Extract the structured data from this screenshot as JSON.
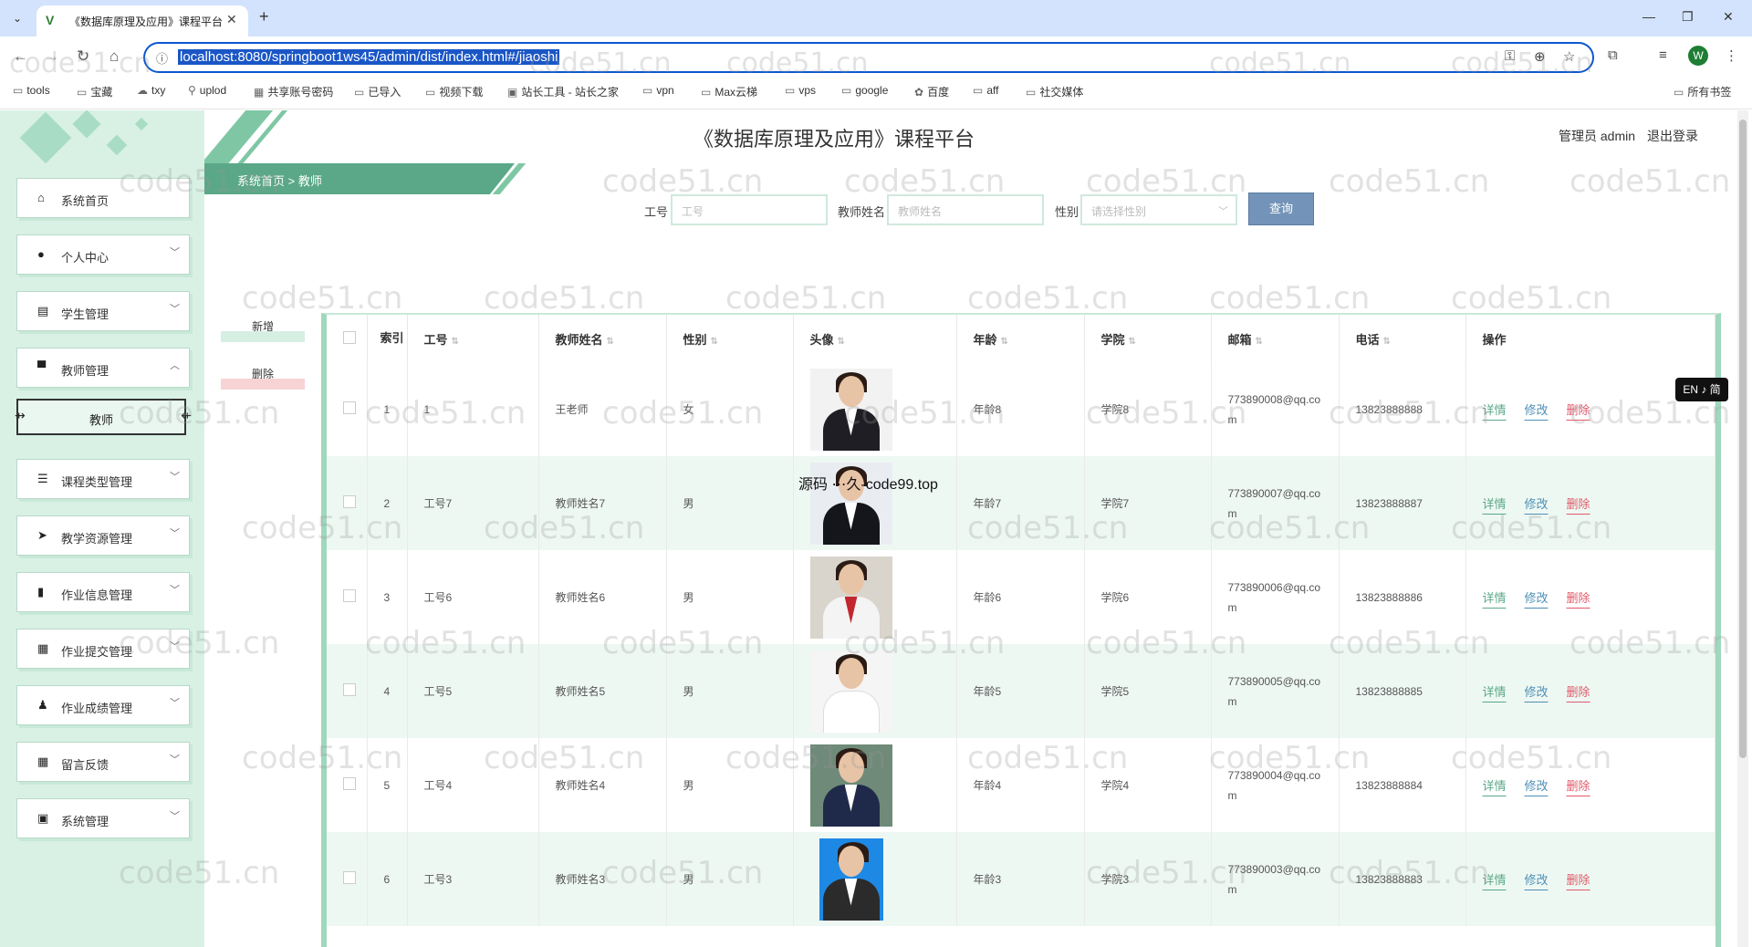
{
  "browser": {
    "tab_title": "《数据库原理及应用》课程平台",
    "favicon": "V",
    "url": "localhost:8080/springboot1ws45/admin/dist/index.html#/jiaoshi",
    "profile_initial": "W",
    "bookmarks": [
      "tools",
      "宝藏",
      "txy",
      "uplod",
      "共享账号密码",
      "已导入",
      "视频下载",
      "站长工具 - 站长之家",
      "vpn",
      "Max云梯",
      "vps",
      "google",
      "百度",
      "aff",
      "社交媒体"
    ],
    "all_bookmarks": "所有书签"
  },
  "header": {
    "title": "《数据库原理及应用》课程平台",
    "user": "管理员 admin",
    "logout": "退出登录",
    "breadcrumb_home": "系统首页",
    "breadcrumb_sep": ">",
    "breadcrumb_current": "教师"
  },
  "sidebar": {
    "items": [
      {
        "label": "系统首页",
        "icon": "home-icon"
      },
      {
        "label": "个人中心",
        "icon": "user-icon"
      },
      {
        "label": "学生管理",
        "icon": "chat-icon"
      },
      {
        "label": "教师管理",
        "icon": "monitor-icon"
      },
      {
        "label": "课程类型管理",
        "icon": "list-icon"
      },
      {
        "label": "教学资源管理",
        "icon": "send-icon"
      },
      {
        "label": "作业信息管理",
        "icon": "chart-icon"
      },
      {
        "label": "作业提交管理",
        "icon": "grid-icon"
      },
      {
        "label": "作业成绩管理",
        "icon": "person-icon"
      },
      {
        "label": "留言反馈",
        "icon": "grid-icon"
      },
      {
        "label": "系统管理",
        "icon": "calendar-icon"
      }
    ],
    "sub_item": "教师"
  },
  "search": {
    "gonghao_label": "工号",
    "gonghao_placeholder": "工号",
    "name_label": "教师姓名",
    "name_placeholder": "教师姓名",
    "gender_label": "性别",
    "gender_placeholder": "请选择性别",
    "button": "查询"
  },
  "actions": {
    "add": "新增",
    "delete": "删除"
  },
  "table": {
    "headers": [
      "索引",
      "工号",
      "教师姓名",
      "性别",
      "头像",
      "年龄",
      "学院",
      "邮箱",
      "电话",
      "操作"
    ],
    "ops": {
      "detail": "详情",
      "edit": "修改",
      "delete": "删除"
    },
    "rows": [
      {
        "index": "1",
        "gonghao": "1",
        "name": "王老师",
        "gender": "女",
        "age": "年龄8",
        "college": "学院8",
        "email": "773890008@qq.com",
        "phone": "13823888888"
      },
      {
        "index": "2",
        "gonghao": "工号7",
        "name": "教师姓名7",
        "gender": "男",
        "age": "年龄7",
        "college": "学院7",
        "email": "773890007@qq.com",
        "phone": "13823888887"
      },
      {
        "index": "3",
        "gonghao": "工号6",
        "name": "教师姓名6",
        "gender": "男",
        "age": "年龄6",
        "college": "学院6",
        "email": "773890006@qq.com",
        "phone": "13823888886"
      },
      {
        "index": "4",
        "gonghao": "工号5",
        "name": "教师姓名5",
        "gender": "男",
        "age": "年龄5",
        "college": "学院5",
        "email": "773890005@qq.com",
        "phone": "13823888885"
      },
      {
        "index": "5",
        "gonghao": "工号4",
        "name": "教师姓名4",
        "gender": "男",
        "age": "年龄4",
        "college": "学院4",
        "email": "773890004@qq.com",
        "phone": "13823888884"
      },
      {
        "index": "6",
        "gonghao": "工号3",
        "name": "教师姓名3",
        "gender": "男",
        "age": "年龄3",
        "college": "学院3",
        "email": "773890003@qq.com",
        "phone": "13823888883"
      }
    ]
  },
  "lang_badge": "EN ♪ 简",
  "overlay_text": "源码 ⋯久-code99.top",
  "watermark": "code51.cn",
  "colors": {
    "accent": "#5aa888",
    "sidebar_bg": "#d9f1e5",
    "search_btn": "#7394b8",
    "delete": "#e05a6a",
    "edit": "#4d8fb5"
  }
}
